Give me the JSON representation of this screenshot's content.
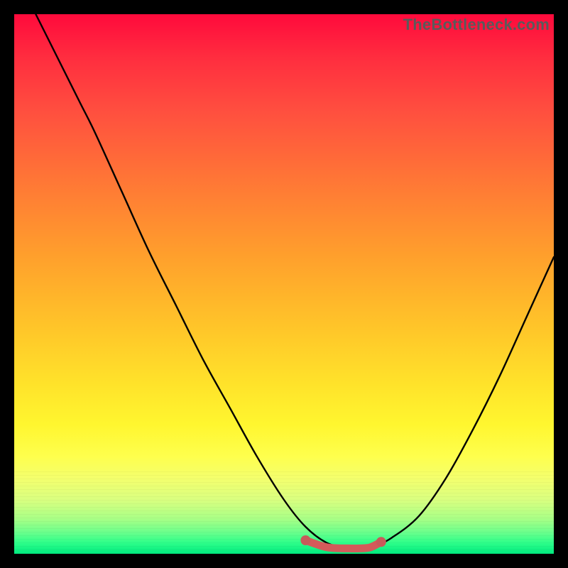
{
  "watermark": "TheBottleneck.com",
  "colors": {
    "curve_stroke": "#000000",
    "segment_stroke": "#d45a5a",
    "segment_dot": "#c85a5a"
  },
  "chart_data": {
    "type": "line",
    "title": "",
    "xlabel": "",
    "ylabel": "",
    "xlim": [
      0,
      100
    ],
    "ylim": [
      0,
      100
    ],
    "series": [
      {
        "name": "curve",
        "x": [
          0,
          6,
          12,
          15,
          20,
          25,
          30,
          35,
          40,
          45,
          50,
          54,
          58,
          62,
          64,
          66,
          70,
          75,
          80,
          85,
          90,
          95,
          100
        ],
        "y": [
          108,
          96,
          84,
          78,
          67,
          56,
          46,
          36,
          27,
          18,
          10,
          5,
          2,
          1,
          1,
          1,
          3,
          7,
          14,
          23,
          33,
          44,
          55
        ]
      },
      {
        "name": "bottom-segment",
        "x": [
          54,
          58,
          62,
          64,
          66,
          68
        ],
        "y": [
          2.5,
          1.2,
          1.0,
          1.0,
          1.2,
          2.2
        ]
      }
    ],
    "segment_endpoints": {
      "left": {
        "x": 54,
        "y": 2.5
      },
      "right": {
        "x": 68,
        "y": 2.2
      }
    }
  }
}
